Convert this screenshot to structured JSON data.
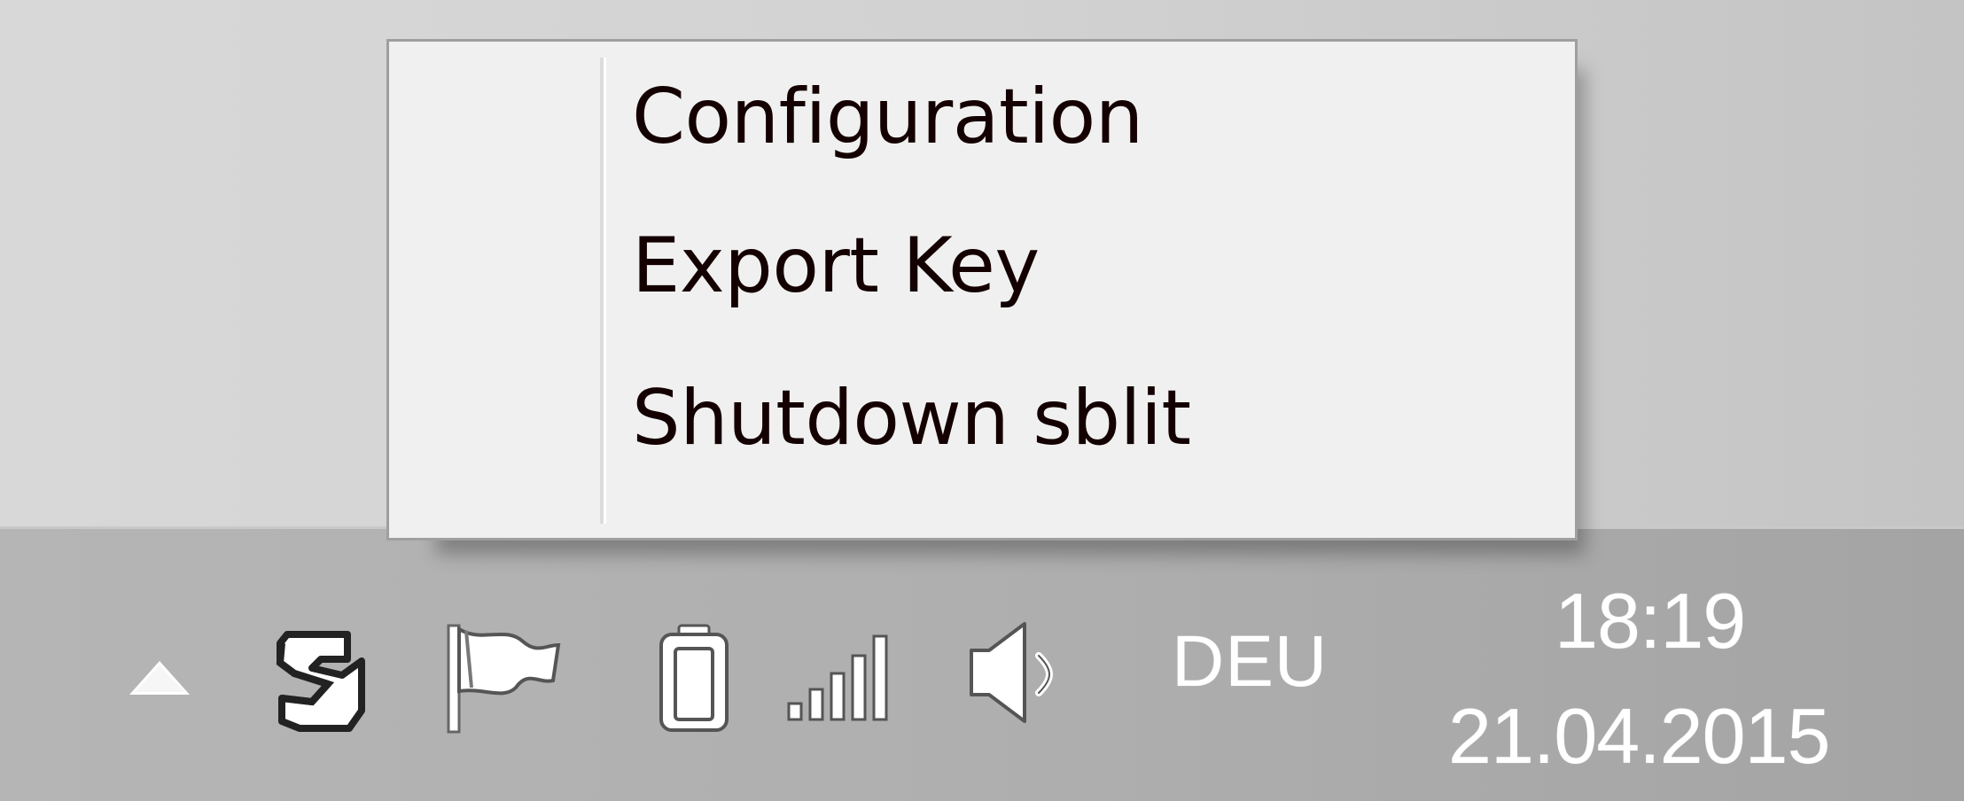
{
  "context_menu": {
    "items": [
      {
        "label": "Configuration"
      },
      {
        "label": "Export Key"
      },
      {
        "label": "Shutdown sblit"
      }
    ]
  },
  "taskbar": {
    "tray_icons": [
      {
        "name": "show-hidden-icons-chevron-icon"
      },
      {
        "name": "sblit-app-icon"
      },
      {
        "name": "action-center-flag-icon"
      },
      {
        "name": "battery-icon"
      },
      {
        "name": "network-signal-icon"
      },
      {
        "name": "volume-icon"
      }
    ],
    "language": "DEU",
    "time": "18:19",
    "date": "21.04.2015"
  },
  "colors": {
    "menu_background": "#f0f0f0",
    "menu_text": "#140000",
    "taskbar": "#afafaf",
    "tray_text": "#ffffff"
  }
}
